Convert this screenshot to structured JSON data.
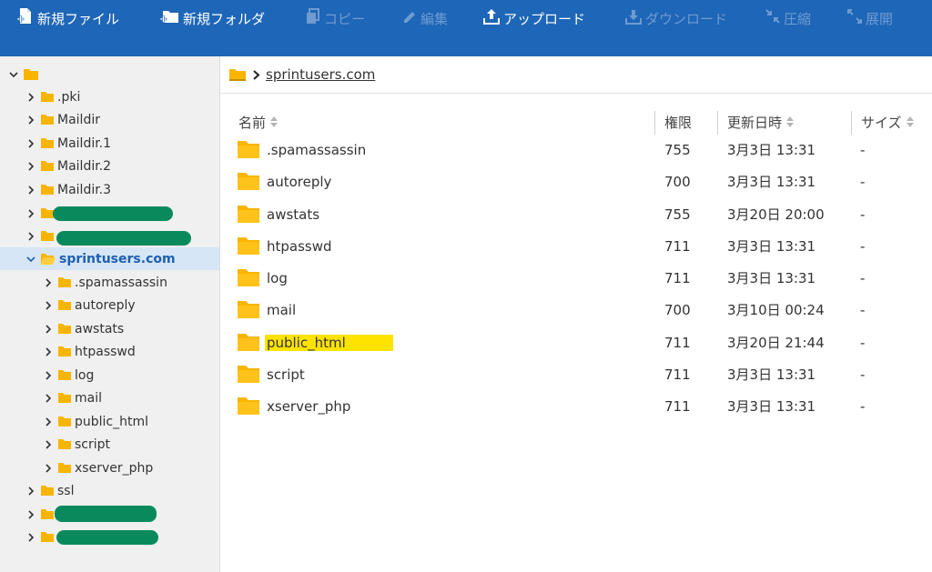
{
  "toolbar": {
    "new_file": "新規ファイル",
    "new_folder": "新規フォルダ",
    "copy": "コピー",
    "edit": "編集",
    "upload": "アップロード",
    "download": "ダウンロード",
    "compress": "圧縮",
    "extract": "展開"
  },
  "tree": {
    "root_label": "",
    "items": [
      {
        "label": ".pki"
      },
      {
        "label": "Maildir"
      },
      {
        "label": "Maildir.1"
      },
      {
        "label": "Maildir.2"
      },
      {
        "label": "Maildir.3"
      },
      {
        "label": ""
      },
      {
        "label": ""
      },
      {
        "label": "sprintusers.com"
      },
      {
        "label": ".spamassassin"
      },
      {
        "label": "autoreply"
      },
      {
        "label": "awstats"
      },
      {
        "label": "htpasswd"
      },
      {
        "label": "log"
      },
      {
        "label": "mail"
      },
      {
        "label": "public_html"
      },
      {
        "label": "script"
      },
      {
        "label": "xserver_php"
      },
      {
        "label": "ssl"
      },
      {
        "label": ""
      },
      {
        "label": ""
      }
    ]
  },
  "breadcrumb": {
    "current": "sprintusers.com"
  },
  "table": {
    "headers": {
      "name": "名前",
      "perm": "権限",
      "modified": "更新日時",
      "size": "サイズ"
    },
    "rows": [
      {
        "name": ".spamassassin",
        "perm": "755",
        "modified": "3月3日 13:31",
        "size": "-"
      },
      {
        "name": "autoreply",
        "perm": "700",
        "modified": "3月3日 13:31",
        "size": "-"
      },
      {
        "name": "awstats",
        "perm": "755",
        "modified": "3月20日 20:00",
        "size": "-"
      },
      {
        "name": "htpasswd",
        "perm": "711",
        "modified": "3月3日 13:31",
        "size": "-"
      },
      {
        "name": "log",
        "perm": "711",
        "modified": "3月3日 13:31",
        "size": "-"
      },
      {
        "name": "mail",
        "perm": "700",
        "modified": "3月10日 00:24",
        "size": "-"
      },
      {
        "name": "public_html",
        "perm": "711",
        "modified": "3月20日 21:44",
        "size": "-"
      },
      {
        "name": "script",
        "perm": "711",
        "modified": "3月3日 13:31",
        "size": "-"
      },
      {
        "name": "xserver_php",
        "perm": "711",
        "modified": "3月3日 13:31",
        "size": "-"
      }
    ]
  },
  "colors": {
    "toolbar_bg": "#1e66b7",
    "folder": "#f7b500",
    "highlight": "#ffe300",
    "redaction": "#0a8a5c"
  }
}
